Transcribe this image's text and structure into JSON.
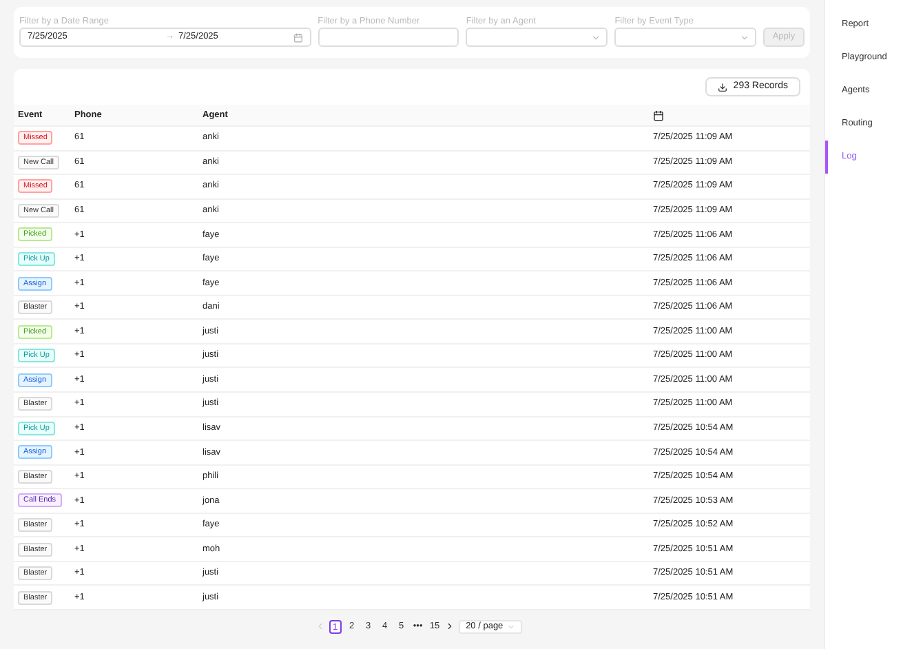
{
  "filters": {
    "date_range": {
      "label": "Filter by a Date Range",
      "start": "7/25/2025",
      "separator": "→",
      "end": "7/25/2025"
    },
    "phone": {
      "label": "Filter by a Phone Number"
    },
    "agent": {
      "label": "Filter by an Agent"
    },
    "event_type": {
      "label": "Filter by Event Type"
    },
    "apply": {
      "label": "Apply",
      "disabled": true
    }
  },
  "records_button": "293 Records",
  "table": {
    "columns": [
      "Event",
      "Phone",
      "Agent"
    ],
    "rows": [
      {
        "event": "Missed",
        "kind": "missed",
        "phone": "61",
        "agent": "anki",
        "time": "7/25/2025 11:09 AM"
      },
      {
        "event": "New Call",
        "kind": "neutral",
        "phone": "61",
        "agent": "anki",
        "time": "7/25/2025 11:09 AM"
      },
      {
        "event": "Missed",
        "kind": "missed",
        "phone": "61",
        "agent": "anki",
        "time": "7/25/2025 11:09 AM"
      },
      {
        "event": "New Call",
        "kind": "neutral",
        "phone": "61",
        "agent": "anki",
        "time": "7/25/2025 11:09 AM"
      },
      {
        "event": "Picked",
        "kind": "picked",
        "phone": "+1",
        "agent": "faye",
        "time": "7/25/2025 11:06 AM"
      },
      {
        "event": "Pick Up",
        "kind": "pickup",
        "phone": "+1",
        "agent": "faye",
        "time": "7/25/2025 11:06 AM"
      },
      {
        "event": "Assign",
        "kind": "assign",
        "phone": "+1",
        "agent": "faye",
        "time": "7/25/2025 11:06 AM"
      },
      {
        "event": "Blaster",
        "kind": "neutral",
        "phone": "+1",
        "agent": "dani",
        "time": "7/25/2025 11:06 AM"
      },
      {
        "event": "Picked",
        "kind": "picked",
        "phone": "+1",
        "agent": "justi",
        "time": "7/25/2025 11:00 AM"
      },
      {
        "event": "Pick Up",
        "kind": "pickup",
        "phone": "+1",
        "agent": "justi",
        "time": "7/25/2025 11:00 AM"
      },
      {
        "event": "Assign",
        "kind": "assign",
        "phone": "+1",
        "agent": "justi",
        "time": "7/25/2025 11:00 AM"
      },
      {
        "event": "Blaster",
        "kind": "neutral",
        "phone": "+1",
        "agent": "justi",
        "time": "7/25/2025 11:00 AM"
      },
      {
        "event": "Pick Up",
        "kind": "pickup",
        "phone": "+1",
        "agent": "lisav",
        "time": "7/25/2025 10:54 AM"
      },
      {
        "event": "Assign",
        "kind": "assign",
        "phone": "+1",
        "agent": "lisav",
        "time": "7/25/2025 10:54 AM"
      },
      {
        "event": "Blaster",
        "kind": "neutral",
        "phone": "+1",
        "agent": "phili",
        "time": "7/25/2025 10:54 AM"
      },
      {
        "event": "Call Ends",
        "kind": "ended",
        "phone": "+1",
        "agent": "jona",
        "time": "7/25/2025 10:53 AM"
      },
      {
        "event": "Blaster",
        "kind": "neutral",
        "phone": "+1",
        "agent": "faye",
        "time": "7/25/2025 10:52 AM"
      },
      {
        "event": "Blaster",
        "kind": "neutral",
        "phone": "+1",
        "agent": "moh",
        "time": "7/25/2025 10:51 AM"
      },
      {
        "event": "Blaster",
        "kind": "neutral",
        "phone": "+1",
        "agent": "justi",
        "time": "7/25/2025 10:51 AM"
      },
      {
        "event": "Blaster",
        "kind": "neutral",
        "phone": "+1",
        "agent": "justi",
        "time": "7/25/2025 10:51 AM"
      }
    ]
  },
  "pagination": {
    "prev": {
      "disabled": true
    },
    "pages": [
      {
        "label": "1",
        "selected": true
      },
      {
        "label": "2",
        "selected": false
      },
      {
        "label": "3",
        "selected": false
      },
      {
        "label": "4",
        "selected": false
      },
      {
        "label": "5",
        "selected": false
      },
      {
        "label": "•••",
        "selected": false
      },
      {
        "label": "15",
        "selected": false
      }
    ],
    "next": {
      "disabled": false
    },
    "page_size": "20 / page"
  },
  "sidebar": {
    "items": [
      {
        "label": "Report",
        "selected": false
      },
      {
        "label": "Playground",
        "selected": false
      },
      {
        "label": "Agents",
        "selected": false
      },
      {
        "label": "Routing",
        "selected": false
      },
      {
        "label": "Log",
        "selected": true
      }
    ]
  }
}
